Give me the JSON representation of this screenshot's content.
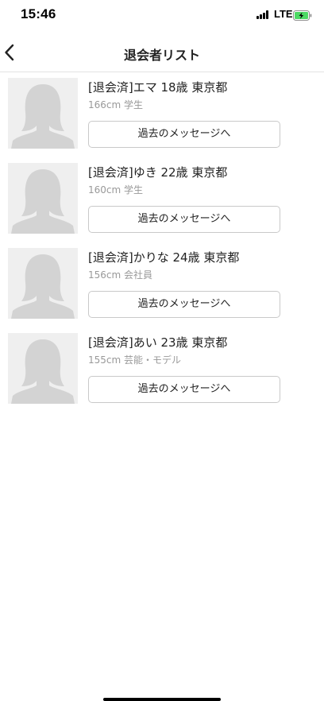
{
  "status_bar": {
    "time": "15:46",
    "network": "LTE",
    "battery_color": "#4cd964"
  },
  "header": {
    "title": "退会者リスト",
    "back_icon": "chevron-left-icon"
  },
  "users": [
    {
      "name": "[退会済]エマ 18歳 東京都",
      "meta": "166cm 学生",
      "button": "過去のメッセージへ"
    },
    {
      "name": "[退会済]ゆき 22歳 東京都",
      "meta": "160cm 学生",
      "button": "過去のメッセージへ"
    },
    {
      "name": "[退会済]かりな 24歳 東京都",
      "meta": "156cm 会社員",
      "button": "過去のメッセージへ"
    },
    {
      "name": "[退会済]あい 23歳 東京都",
      "meta": "155cm 芸能・モデル",
      "button": "過去のメッセージへ"
    }
  ],
  "colors": {
    "avatar_bg": "#efefef",
    "avatar_silhouette": "#d3d3d3",
    "meta_text": "#999999",
    "divider": "#e3e3e3"
  }
}
